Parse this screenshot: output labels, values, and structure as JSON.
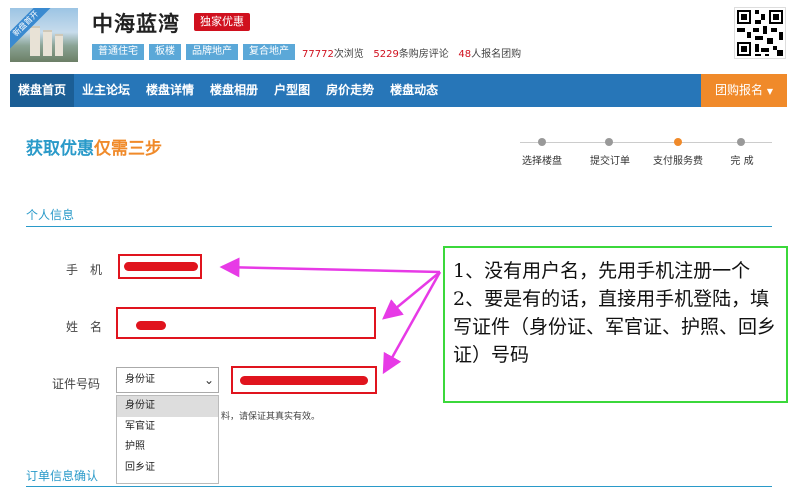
{
  "header": {
    "logo_ribbon": "新盘首开",
    "title": "中海蓝湾",
    "exclusive_badge": "独家优惠",
    "tags": [
      "普通住宅",
      "板楼",
      "品牌地产",
      "复合地产"
    ],
    "stats": {
      "views_num": "77772",
      "views_label": "次浏览",
      "comments_num": "5229",
      "comments_label": "条购房评论",
      "signups_num": "48",
      "signups_label": "人报名团购"
    }
  },
  "nav": {
    "items": [
      "楼盘首页",
      "业主论坛",
      "楼盘详情",
      "楼盘相册",
      "户型图",
      "房价走势",
      "楼盘动态"
    ],
    "group_button": "团购报名"
  },
  "steps": {
    "title_part1": "获取优惠",
    "title_part2": "仅需三步",
    "items": [
      "选择楼盘",
      "提交订单",
      "支付服务费",
      "完 成"
    ],
    "current_index": 2
  },
  "personal": {
    "section_title": "个人信息",
    "phone_label": "手　机",
    "name_label": "姓　名",
    "id_label": "证件号码",
    "id_select_value": "身份证",
    "id_options": [
      "身份证",
      "军官证",
      "护照",
      "回乡证"
    ],
    "note": "料，请保证其真实有效。"
  },
  "order": {
    "section_title": "订单信息确认"
  },
  "annotation": {
    "line1": "1、没有用户名，先用手机注册一个",
    "line2": "2、要是有的话，直接用手机登陆，填写证件（身份证、军官证、护照、回乡证）号码"
  },
  "colors": {
    "accent": "#2a9ac9",
    "nav": "#2776b8",
    "orange": "#f08a2a",
    "red": "#e0141e",
    "annotation_border": "#3bd83b",
    "arrow": "#e73ae6"
  }
}
